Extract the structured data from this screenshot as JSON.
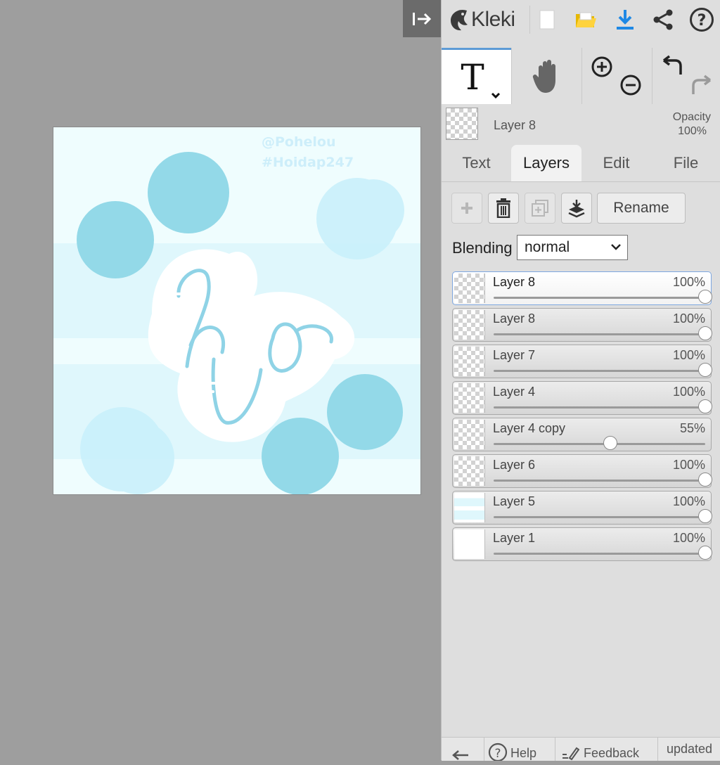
{
  "app": {
    "name": "Kleki"
  },
  "toolbar": {
    "icons": [
      "collapse-panel-icon",
      "kleki-logo-icon",
      "new-image-icon",
      "open-folder-icon",
      "download-icon",
      "share-icon",
      "help-icon"
    ]
  },
  "tools": {
    "active": "text-tool",
    "items": [
      "text-tool",
      "hand-tool",
      "zoom-in",
      "zoom-out",
      "undo",
      "redo"
    ]
  },
  "current_layer": {
    "name": "Layer 8",
    "opacity_label": "Opacity",
    "opacity_value": "100%"
  },
  "tabs": [
    {
      "label": "Text",
      "active": false
    },
    {
      "label": "Layers",
      "active": true
    },
    {
      "label": "Edit",
      "active": false
    },
    {
      "label": "File",
      "active": false
    }
  ],
  "layer_tools": {
    "rename_label": "Rename"
  },
  "blending": {
    "label": "Blending",
    "value": "normal"
  },
  "layers": [
    {
      "name": "Layer 8",
      "opacity": "100%",
      "opacity_fraction": 1.0,
      "selected": true
    },
    {
      "name": "Layer 8",
      "opacity": "100%",
      "opacity_fraction": 1.0,
      "selected": false
    },
    {
      "name": "Layer 7",
      "opacity": "100%",
      "opacity_fraction": 1.0,
      "selected": false
    },
    {
      "name": "Layer 4",
      "opacity": "100%",
      "opacity_fraction": 1.0,
      "selected": false
    },
    {
      "name": "Layer 4 copy",
      "opacity": "55%",
      "opacity_fraction": 0.55,
      "selected": false
    },
    {
      "name": "Layer 6",
      "opacity": "100%",
      "opacity_fraction": 1.0,
      "selected": false
    },
    {
      "name": "Layer 5",
      "opacity": "100%",
      "opacity_fraction": 1.0,
      "selected": false
    },
    {
      "name": "Layer 1",
      "opacity": "100%",
      "opacity_fraction": 1.0,
      "selected": false
    }
  ],
  "canvas": {
    "watermark_line1": "@Pohelou",
    "watermark_line2": "#Hoidap247",
    "colors": {
      "background": "#effdfe",
      "circle": "#93d9e8",
      "stripe": "#dff7fc",
      "blob": "#c8f0fb"
    }
  },
  "footer": {
    "help_label": "Help",
    "feedback_label": "Feedback",
    "updated_label": "updated"
  }
}
